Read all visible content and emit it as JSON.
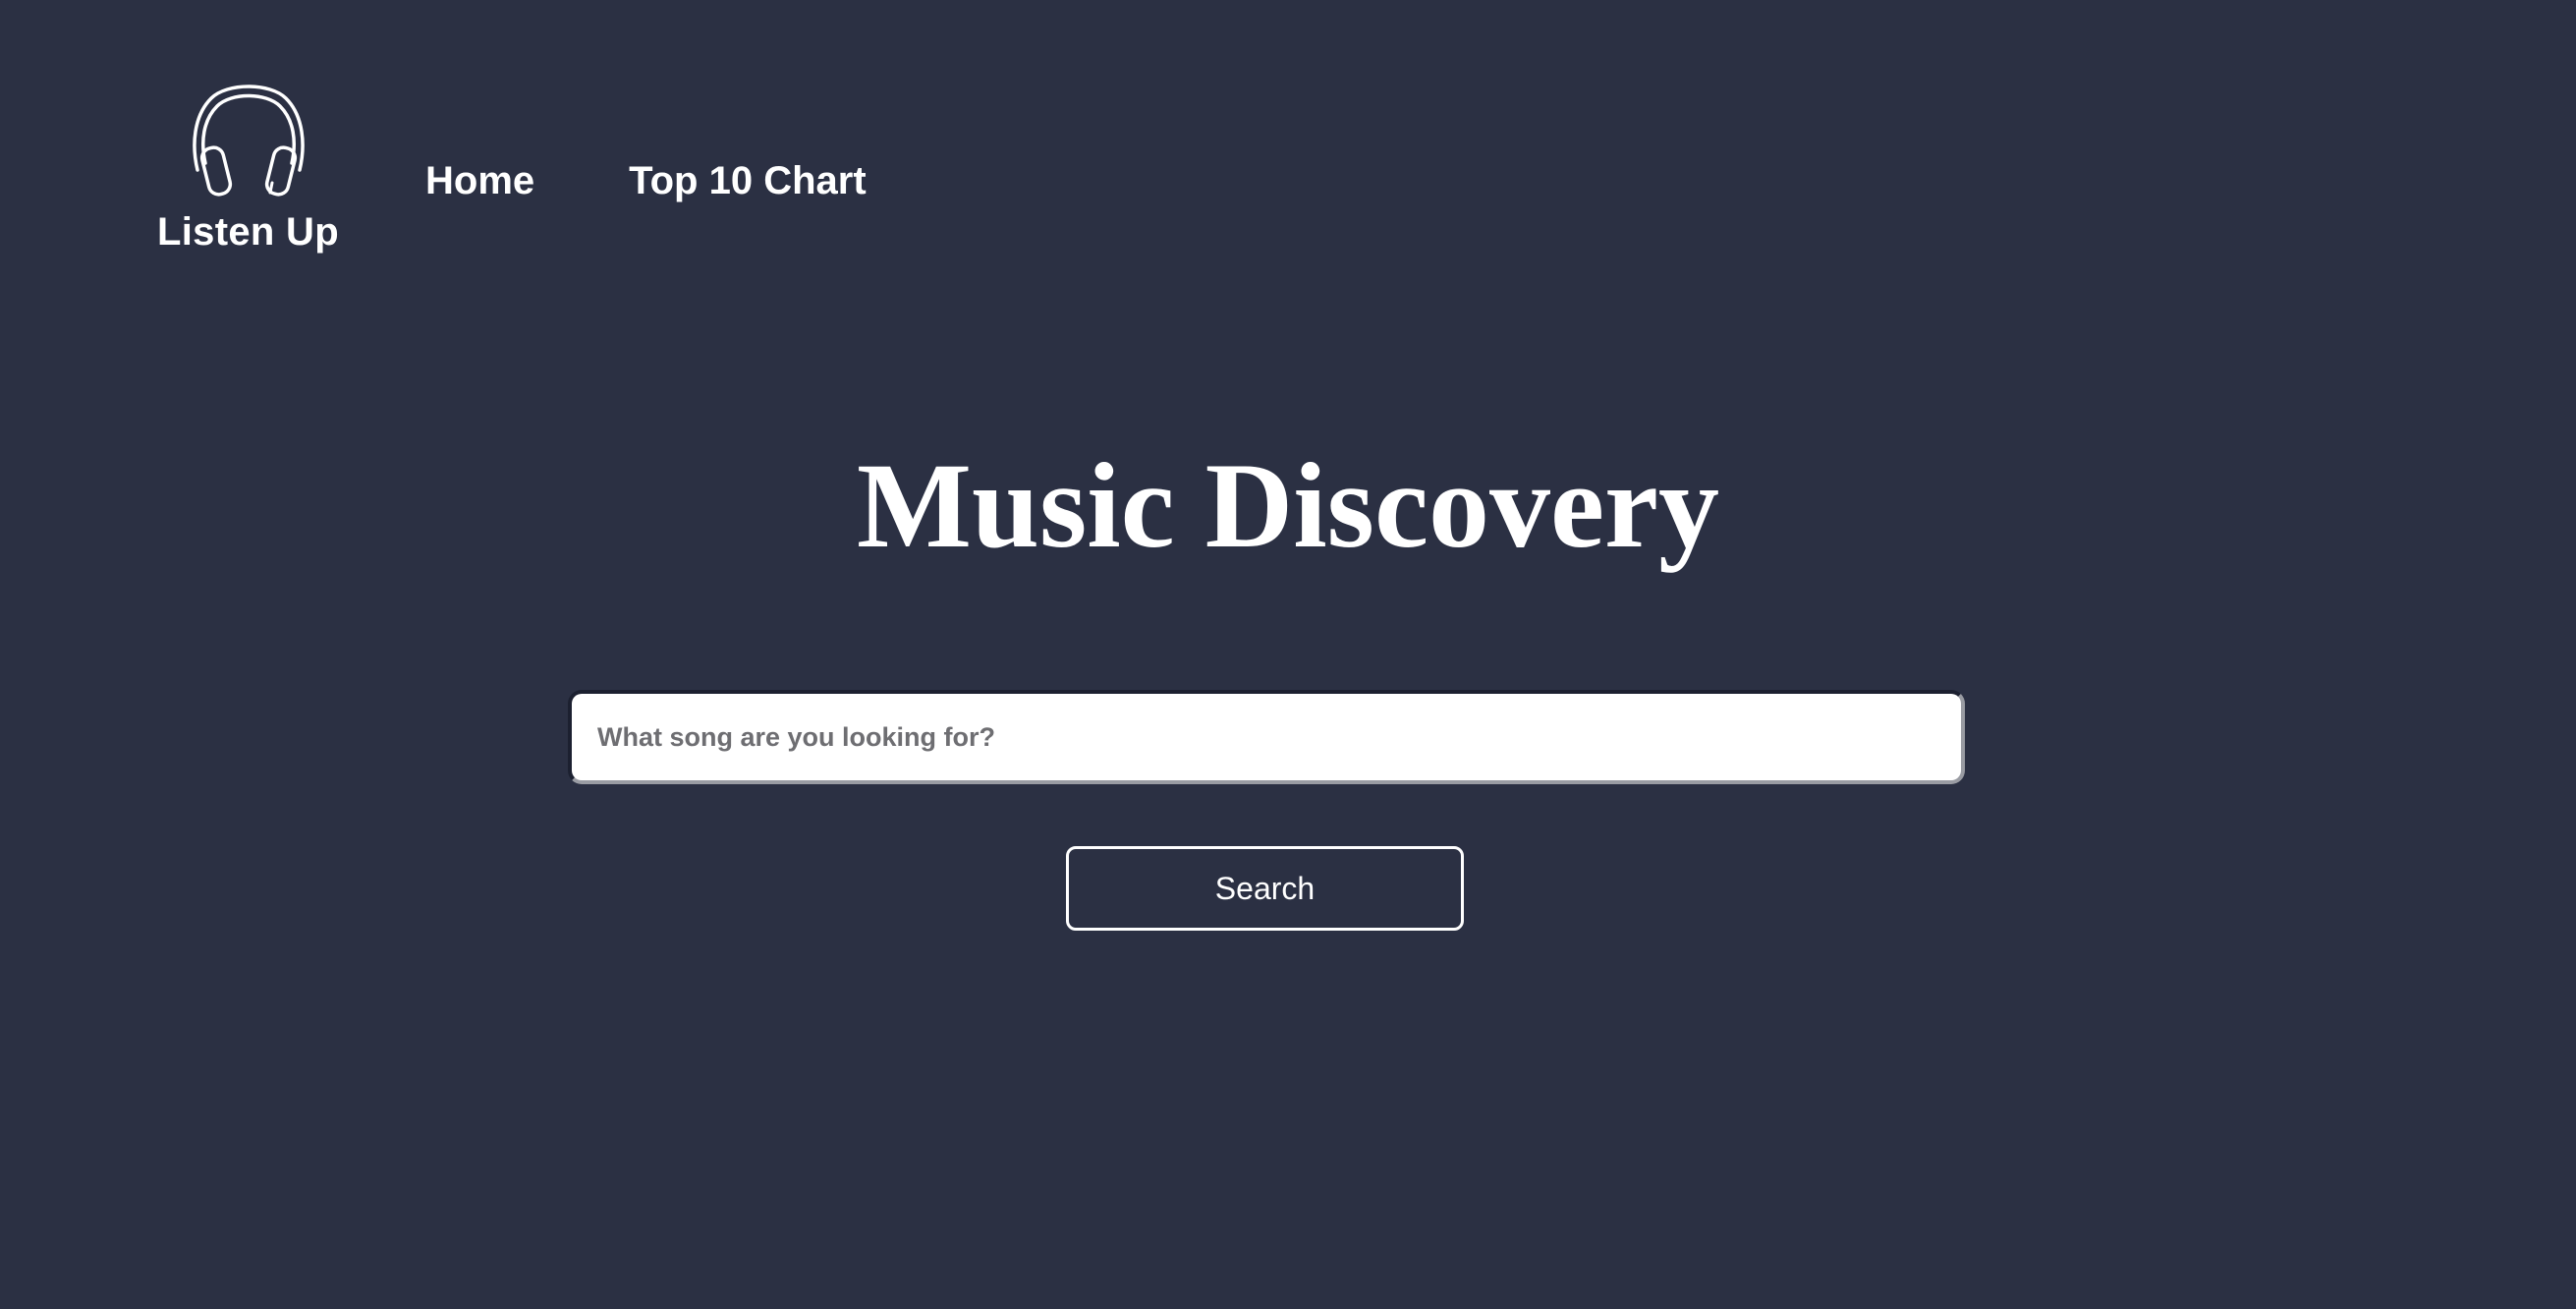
{
  "app": {
    "brand": "Listen Up",
    "logo_icon": "headphones-icon"
  },
  "nav": {
    "items": [
      {
        "label": "Home"
      },
      {
        "label": "Top 10 Chart"
      }
    ]
  },
  "main": {
    "title": "Music Discovery",
    "search": {
      "placeholder": "What song are you looking for?",
      "value": ""
    },
    "search_button_label": "Search"
  },
  "colors": {
    "background": "#2b3043",
    "text": "#ffffff",
    "input_background": "#ffffff",
    "placeholder": "#6e6e72"
  }
}
